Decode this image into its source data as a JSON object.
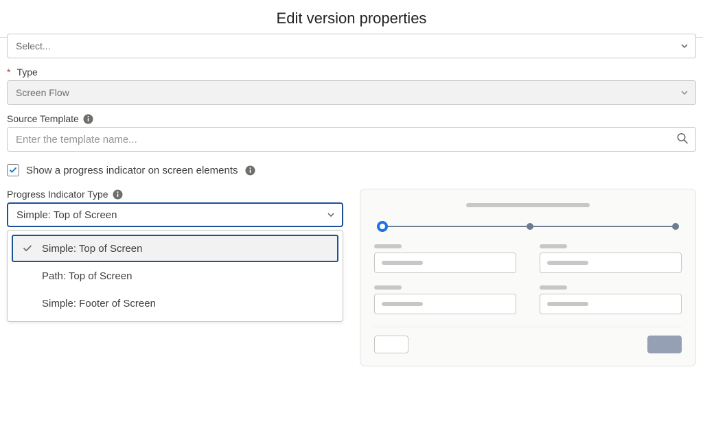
{
  "header": {
    "title": "Edit version properties"
  },
  "run": {
    "placeholder": "Select..."
  },
  "type": {
    "label": "Type",
    "value": "Screen Flow"
  },
  "source": {
    "label": "Source Template",
    "placeholder": "Enter the template name..."
  },
  "showProgress": {
    "label": "Show a progress indicator on screen elements",
    "checked": true
  },
  "progressIndicator": {
    "label": "Progress Indicator Type",
    "value": "Simple: Top of Screen",
    "options": [
      "Simple: Top of Screen",
      "Path: Top of Screen",
      "Simple: Footer of Screen"
    ]
  }
}
